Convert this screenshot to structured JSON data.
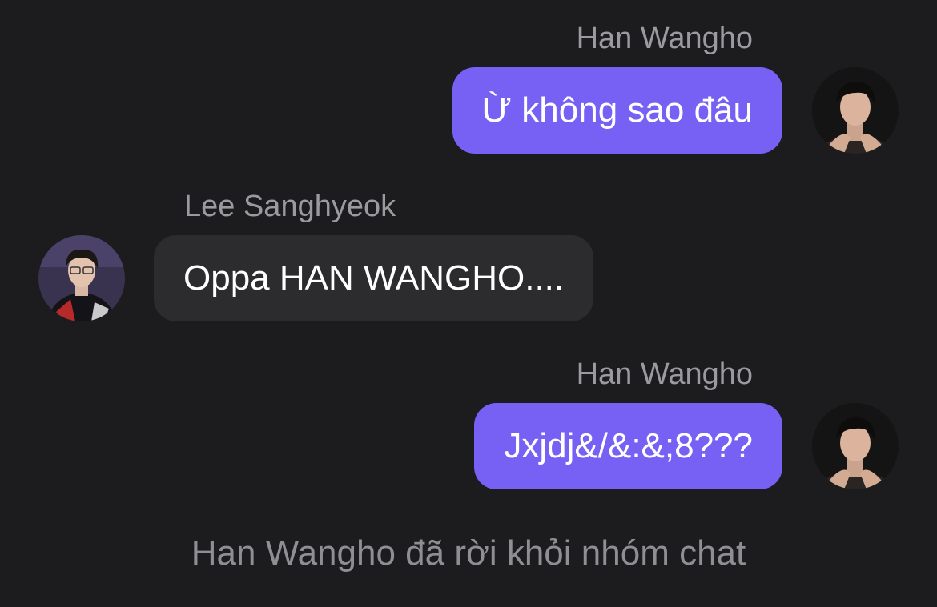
{
  "messages": [
    {
      "sender": "Han Wangho",
      "text": "Ừ không sao đâu",
      "direction": "outgoing",
      "avatar_icon": "han-wangho-avatar"
    },
    {
      "sender": "Lee Sanghyeok",
      "text": "Oppa HAN WANGHO....",
      "direction": "incoming",
      "avatar_icon": "lee-sanghyeok-avatar"
    },
    {
      "sender": "Han Wangho",
      "text": "Jxjdj&/&:&;8???",
      "direction": "outgoing",
      "avatar_icon": "han-wangho-avatar"
    }
  ],
  "system_notice": "Han Wangho đã rời khỏi nhóm chat",
  "colors": {
    "background": "#1c1c1e",
    "outgoing_bubble": "#7761f5",
    "incoming_bubble": "#2c2c2e",
    "sender_name": "#9a9a9f",
    "system_text": "#8e8e93"
  }
}
